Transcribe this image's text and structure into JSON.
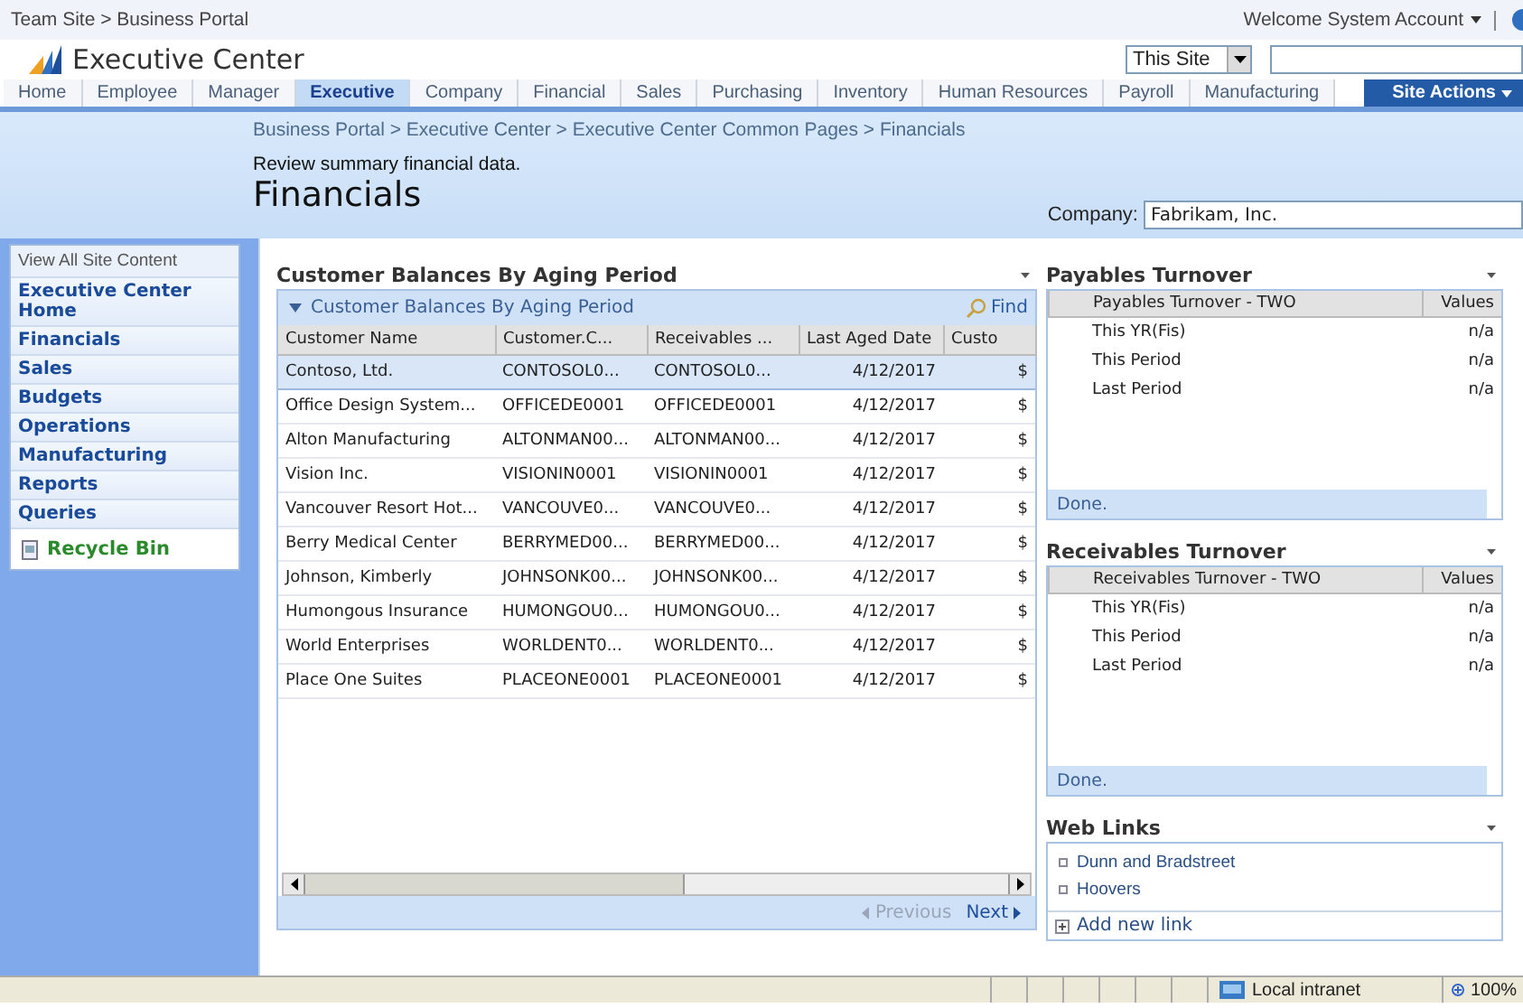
{
  "top_bar": {
    "breadcrumb": "Team Site > Business Portal",
    "welcome": "Welcome System Account"
  },
  "header": {
    "site_title": "Executive Center",
    "scope": "This Site"
  },
  "nav_tabs": [
    {
      "label": "Home",
      "selected": false
    },
    {
      "label": "Employee",
      "selected": false
    },
    {
      "label": "Manager",
      "selected": false
    },
    {
      "label": "Executive",
      "selected": true
    },
    {
      "label": "Company",
      "selected": false
    },
    {
      "label": "Financial",
      "selected": false
    },
    {
      "label": "Sales",
      "selected": false
    },
    {
      "label": "Purchasing",
      "selected": false
    },
    {
      "label": "Inventory",
      "selected": false
    },
    {
      "label": "Human Resources",
      "selected": false
    },
    {
      "label": "Payroll",
      "selected": false
    },
    {
      "label": "Manufacturing",
      "selected": false
    }
  ],
  "site_actions": "Site Actions",
  "page": {
    "breadcrumb": "Business Portal > Executive Center > Executive Center Common Pages > Financials",
    "description": "Review summary financial data.",
    "title": "Financials",
    "company_label": "Company:",
    "company_value": "Fabrikam, Inc."
  },
  "sidebar": {
    "view_all": "View All Site Content",
    "items": [
      "Executive Center Home",
      "Financials",
      "Sales",
      "Budgets",
      "Operations",
      "Manufacturing",
      "Reports",
      "Queries"
    ],
    "recycle_bin": "Recycle Bin"
  },
  "customer_balances": {
    "title": "Customer Balances By Aging Period",
    "list_title": "Customer Balances By Aging Period",
    "find": "Find",
    "columns": [
      "Customer Name",
      "Customer.C...",
      "Receivables ...",
      "Last Aged Date",
      "Custo"
    ],
    "rows": [
      {
        "cells": [
          "Contoso, Ltd.",
          "CONTOSOL0...",
          "CONTOSOL0...",
          "4/12/2017",
          "$"
        ],
        "selected": true
      },
      {
        "cells": [
          "Office Design System...",
          "OFFICEDE0001",
          "OFFICEDE0001",
          "4/12/2017",
          "$"
        ],
        "selected": false
      },
      {
        "cells": [
          "Alton Manufacturing",
          "ALTONMAN00...",
          "ALTONMAN00...",
          "4/12/2017",
          "$"
        ],
        "selected": false
      },
      {
        "cells": [
          "Vision Inc.",
          "VISIONIN0001",
          "VISIONIN0001",
          "4/12/2017",
          "$"
        ],
        "selected": false
      },
      {
        "cells": [
          "Vancouver Resort Hot...",
          "VANCOUVE0...",
          "VANCOUVE0...",
          "4/12/2017",
          "$"
        ],
        "selected": false
      },
      {
        "cells": [
          "Berry Medical Center",
          "BERRYMED00...",
          "BERRYMED00...",
          "4/12/2017",
          "$"
        ],
        "selected": false
      },
      {
        "cells": [
          "Johnson, Kimberly",
          "JOHNSONK00...",
          "JOHNSONK00...",
          "4/12/2017",
          "$"
        ],
        "selected": false
      },
      {
        "cells": [
          "Humongous Insurance",
          "HUMONGOU0...",
          "HUMONGOU0...",
          "4/12/2017",
          "$"
        ],
        "selected": false
      },
      {
        "cells": [
          "World Enterprises",
          "WORLDENT0...",
          "WORLDENT0...",
          "4/12/2017",
          "$"
        ],
        "selected": false
      },
      {
        "cells": [
          "Place One Suites",
          "PLACEONE0001",
          "PLACEONE0001",
          "4/12/2017",
          "$"
        ],
        "selected": false
      }
    ],
    "pager": [
      {
        "label": "Previous",
        "disabled": true
      },
      {
        "label": "Next",
        "disabled": false
      }
    ]
  },
  "turnover_parts": [
    {
      "title": "Payables Turnover",
      "columns": [
        "Payables Turnover - TWO",
        "Values"
      ],
      "rows": [
        [
          "This YR(Fis)",
          "n/a"
        ],
        [
          "This Period",
          "n/a"
        ],
        [
          "Last Period",
          "n/a"
        ]
      ],
      "status": "Done."
    },
    {
      "title": "Receivables Turnover",
      "columns": [
        "Receivables Turnover - TWO",
        "Values"
      ],
      "rows": [
        [
          "This YR(Fis)",
          "n/a"
        ],
        [
          "This Period",
          "n/a"
        ],
        [
          "Last Period",
          "n/a"
        ]
      ],
      "status": "Done."
    }
  ],
  "web_links": {
    "title": "Web Links",
    "links": [
      "Dunn and Bradstreet",
      "Hoovers"
    ],
    "add": "Add new link"
  },
  "status_bar": {
    "zone": "Local intranet",
    "zoom": "100%"
  }
}
